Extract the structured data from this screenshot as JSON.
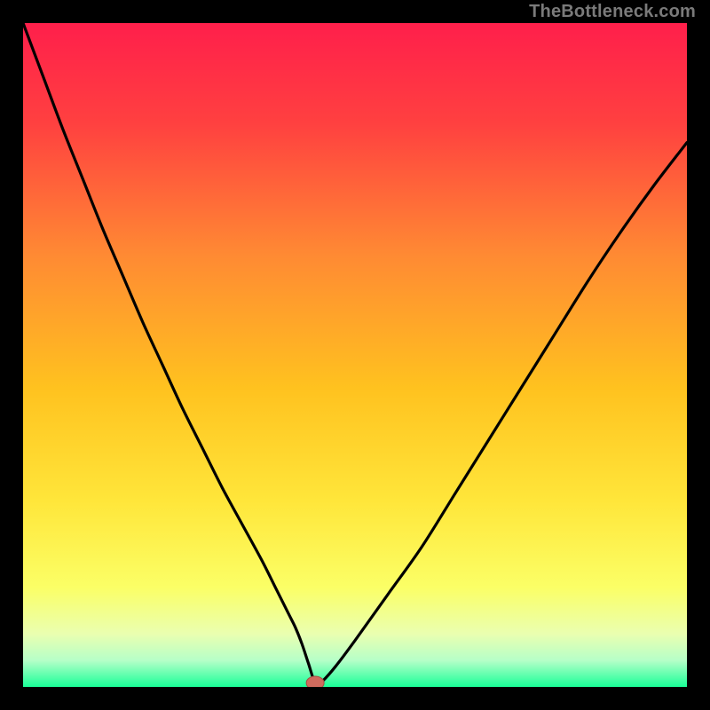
{
  "watermark": "TheBottleneck.com",
  "colors": {
    "frame": "#000000",
    "curve": "#000000",
    "marker_fill": "#cf6a5d",
    "marker_stroke": "#a54d42",
    "gradient_stops": [
      {
        "offset": 0.0,
        "color": "#ff1f4b"
      },
      {
        "offset": 0.15,
        "color": "#ff4040"
      },
      {
        "offset": 0.35,
        "color": "#ff8a33"
      },
      {
        "offset": 0.55,
        "color": "#ffc21f"
      },
      {
        "offset": 0.72,
        "color": "#ffe63a"
      },
      {
        "offset": 0.85,
        "color": "#fbff66"
      },
      {
        "offset": 0.92,
        "color": "#eaffb0"
      },
      {
        "offset": 0.96,
        "color": "#b6ffc8"
      },
      {
        "offset": 1.0,
        "color": "#19ff98"
      }
    ]
  },
  "chart_data": {
    "type": "line",
    "title": "",
    "xlabel": "",
    "ylabel": "",
    "xlim": [
      0,
      100
    ],
    "ylim": [
      0,
      100
    ],
    "x": [
      0,
      3,
      6,
      9,
      12,
      15,
      18,
      21,
      24,
      27,
      30,
      33,
      36,
      38,
      40,
      41,
      42,
      43,
      44,
      45,
      47,
      50,
      55,
      60,
      65,
      70,
      75,
      80,
      85,
      90,
      95,
      100
    ],
    "values": [
      100,
      92,
      84,
      76.5,
      69,
      62,
      55,
      48.5,
      42,
      36,
      30,
      24.5,
      19,
      15,
      11,
      9,
      6.5,
      3.5,
      0.6,
      0.8,
      3,
      7,
      14,
      21,
      29,
      37,
      45,
      53,
      61,
      68.5,
      75.5,
      82
    ],
    "marker_point": {
      "x": 44,
      "y": 0.6
    }
  }
}
